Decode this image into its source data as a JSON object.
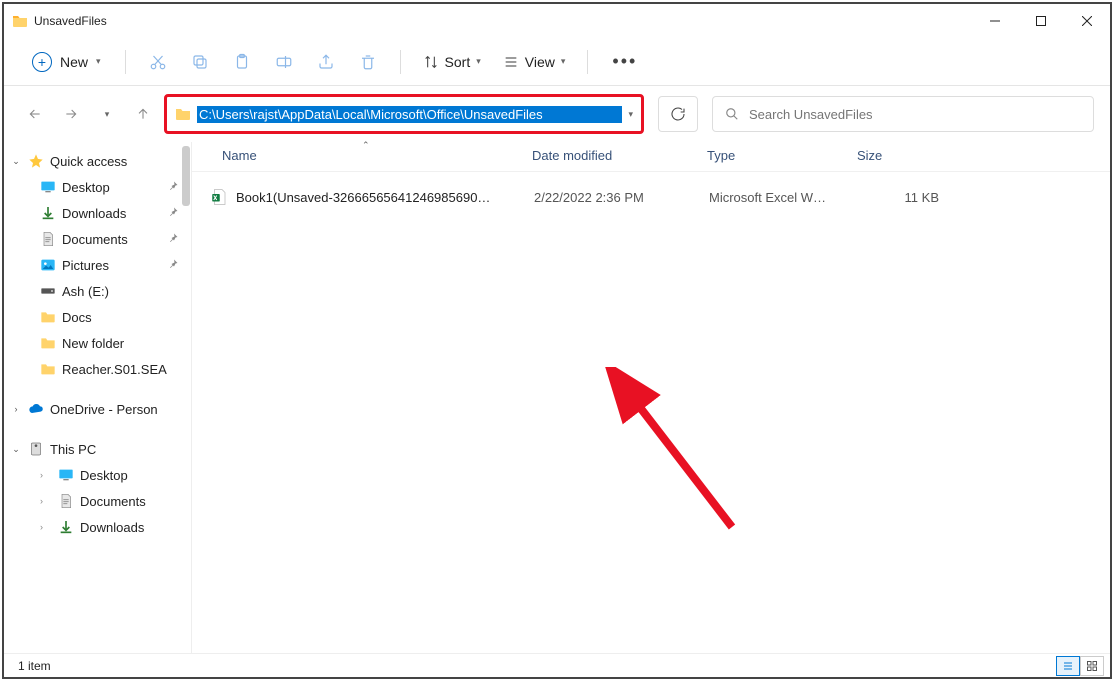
{
  "window": {
    "title": "UnsavedFiles"
  },
  "toolbar": {
    "new_label": "New",
    "sort_label": "Sort",
    "view_label": "View"
  },
  "address": {
    "path": "C:\\Users\\rajst\\AppData\\Local\\Microsoft\\Office\\UnsavedFiles"
  },
  "search": {
    "placeholder": "Search UnsavedFiles"
  },
  "sidebar": {
    "quick_access": "Quick access",
    "items": [
      {
        "label": "Desktop",
        "icon": "desktop",
        "pinned": true
      },
      {
        "label": "Downloads",
        "icon": "downloads",
        "pinned": true
      },
      {
        "label": "Documents",
        "icon": "documents",
        "pinned": true
      },
      {
        "label": "Pictures",
        "icon": "pictures",
        "pinned": true
      },
      {
        "label": "Ash (E:)",
        "icon": "drive",
        "pinned": false
      },
      {
        "label": "Docs",
        "icon": "folder",
        "pinned": false
      },
      {
        "label": "New folder",
        "icon": "folder",
        "pinned": false
      },
      {
        "label": "Reacher.S01.SEA",
        "icon": "folder",
        "pinned": false
      }
    ],
    "onedrive": "OneDrive - Person",
    "this_pc": "This PC",
    "pc_items": [
      {
        "label": "Desktop",
        "icon": "desktop"
      },
      {
        "label": "Documents",
        "icon": "documents"
      },
      {
        "label": "Downloads",
        "icon": "downloads"
      }
    ]
  },
  "columns": {
    "name": "Name",
    "date": "Date modified",
    "type": "Type",
    "size": "Size"
  },
  "files": [
    {
      "name": "Book1(Unsaved-32666565641246985690…",
      "date": "2/22/2022 2:36 PM",
      "type": "Microsoft Excel W…",
      "size": "11 KB"
    }
  ],
  "status": {
    "count": "1 item"
  }
}
